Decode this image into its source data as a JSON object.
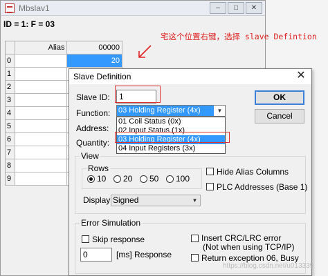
{
  "bg_window": {
    "title": "Mbslav1",
    "status": "ID = 1: F = 03",
    "buttons": [
      "–",
      "□",
      "✕"
    ],
    "grid": {
      "headers": [
        "",
        "Alias",
        "00000"
      ],
      "rows": [
        {
          "index": "0",
          "alias": "",
          "value": "20"
        },
        {
          "index": "1",
          "alias": "",
          "value": ""
        },
        {
          "index": "2",
          "alias": "",
          "value": ""
        },
        {
          "index": "3",
          "alias": "",
          "value": ""
        },
        {
          "index": "4",
          "alias": "",
          "value": ""
        },
        {
          "index": "5",
          "alias": "",
          "value": ""
        },
        {
          "index": "6",
          "alias": "",
          "value": ""
        },
        {
          "index": "7",
          "alias": "",
          "value": ""
        },
        {
          "index": "8",
          "alias": "",
          "value": ""
        },
        {
          "index": "9",
          "alias": "",
          "value": ""
        }
      ]
    }
  },
  "annotation": {
    "text": "宅这个位置右键，选择 slave Defintion",
    "color": "#e02020"
  },
  "dialog": {
    "title": "Slave Definition",
    "close": "✕",
    "slave_id_label": "Slave ID:",
    "slave_id_value": "1",
    "function_label": "Function:",
    "function_selected": "03 Holding Register (4x)",
    "function_options": [
      "01 Coil Status (0x)",
      "02 Input Status (1x)",
      "03 Holding Register (4x)",
      "04 Input Registers (3x)"
    ],
    "address_label": "Address:",
    "quantity_label": "Quantity:",
    "ok": "OK",
    "cancel": "Cancel",
    "view": {
      "legend": "View",
      "rows_legend": "Rows",
      "rows_options": [
        "10",
        "20",
        "50",
        "100"
      ],
      "rows_selected": "10",
      "hide_alias": "Hide Alias Columns",
      "plc_addresses": "PLC Addresses (Base 1)",
      "display_label": "Display:",
      "display_value": "Signed"
    },
    "error_sim": {
      "legend": "Error Simulation",
      "skip_response": "Skip response",
      "response_value": "0",
      "response_label": "[ms] Response",
      "insert_crc": "Insert CRC/LRC error",
      "insert_crc_note": "(Not when using TCP/IP)",
      "return_exception": "Return exception 06, Busy"
    }
  },
  "watermark": "https://blog.csdn.net/u013339",
  "colors": {
    "selection": "#3399ff",
    "highlight_box": "#e03030"
  }
}
